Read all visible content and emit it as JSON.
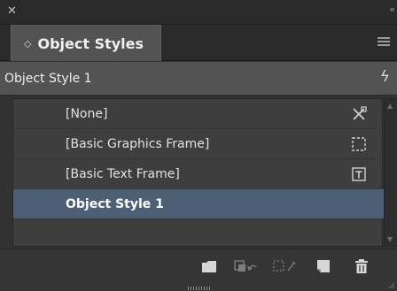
{
  "window": {
    "close_icon": "close-icon",
    "collapse_icon": "collapse-icon"
  },
  "panel": {
    "title": "Object Styles",
    "tab_icon": "expand-arrows-icon",
    "menu_icon": "panel-menu-icon"
  },
  "current_style": {
    "label": "Object Style 1",
    "clear_overrides_icon": "lightning-icon"
  },
  "styles": [
    {
      "label": "[None]",
      "icon": "no-style-icon",
      "selected": false
    },
    {
      "label": "[Basic Graphics Frame]",
      "icon": "graphics-frame-icon",
      "selected": false
    },
    {
      "label": "[Basic Text Frame]",
      "icon": "text-frame-icon",
      "selected": false
    },
    {
      "label": "Object Style 1",
      "icon": "",
      "selected": true
    }
  ],
  "footer": {
    "buttons": [
      "new-style-group-icon",
      "clear-overrides-icon",
      "clear-nondefined-attributes-icon",
      "new-style-icon",
      "delete-icon"
    ]
  },
  "colors": {
    "selection": "#4c5f74",
    "panel_bg": "#323232",
    "header_bar": "#535353"
  }
}
